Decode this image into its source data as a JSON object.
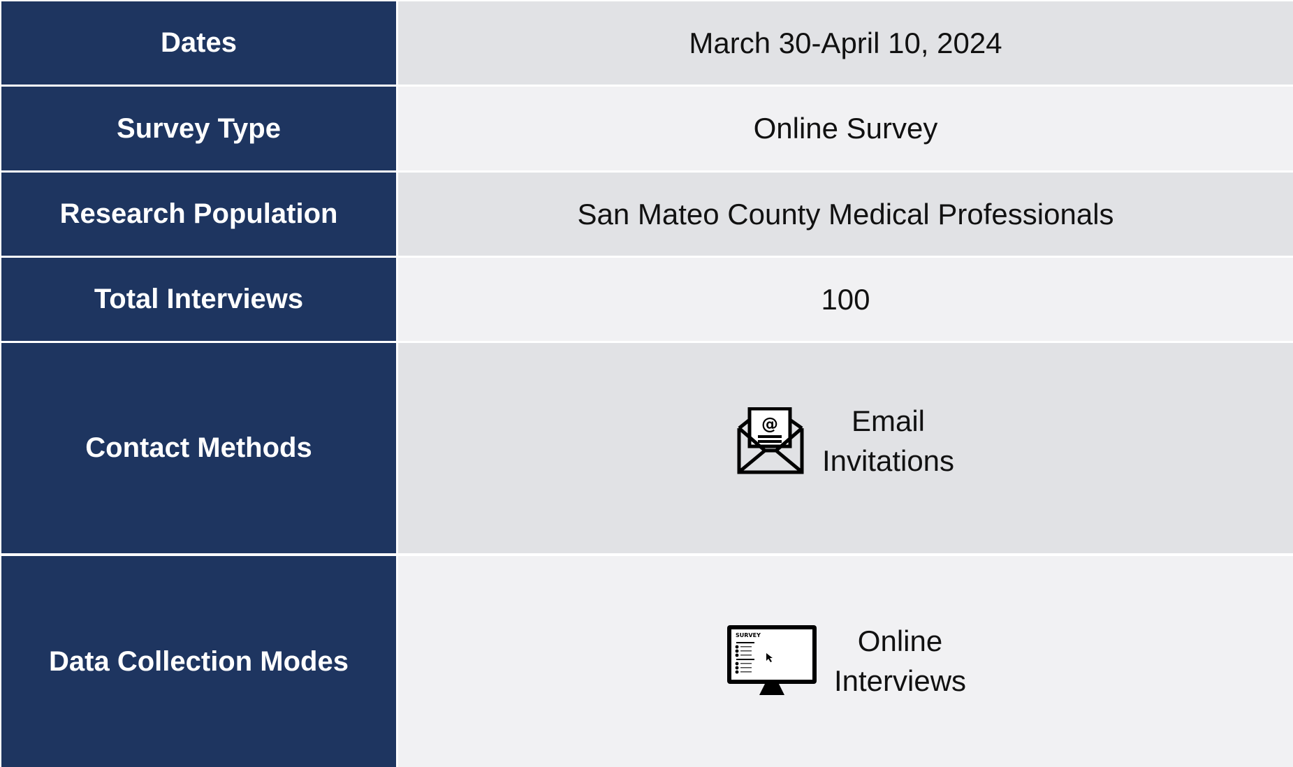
{
  "rows": [
    {
      "label": "Dates",
      "value": "March 30-April 10, 2024"
    },
    {
      "label": "Survey Type",
      "value": "Online Survey"
    },
    {
      "label": "Research Population",
      "value": "San Mateo County Medical Professionals"
    },
    {
      "label": "Total Interviews",
      "value": "100"
    },
    {
      "label": "Contact Methods",
      "value_line1": "Email",
      "value_line2": "Invitations",
      "icon": "email-envelope-icon"
    },
    {
      "label": "Data Collection Modes",
      "value_line1": "Online",
      "value_line2": "Interviews",
      "icon": "computer-survey-icon",
      "icon_text": "SURVEY"
    }
  ],
  "colors": {
    "label_bg": "#1e3560",
    "value_bg_dark": "#e1e2e5",
    "value_bg_light": "#f1f1f3"
  }
}
